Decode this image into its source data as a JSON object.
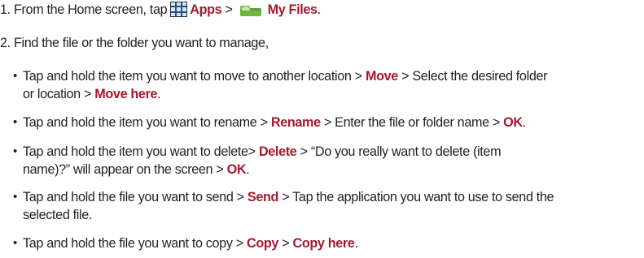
{
  "step1": {
    "number": "1.",
    "text_a": "From the Home screen, tap",
    "apps_label": "Apps",
    "sep": ">",
    "files_label": "My Files",
    "end": "."
  },
  "step2": {
    "number": "2.",
    "text": "Find the file or the folder you want to manage,"
  },
  "bullet_char": "•",
  "move": {
    "t1": "Tap and hold the item you want to move to another location >",
    "k1": "Move",
    "t2": "> Select the desired folder",
    "t3": "or location >",
    "k2": "Move here",
    "end": "."
  },
  "rename": {
    "t1": "Tap and hold the item you want to rename >",
    "k1": "Rename",
    "t2": "> Enter the file or folder name >",
    "k2": "OK",
    "end": "."
  },
  "delete": {
    "t1": "Tap and hold the item you want to delete>",
    "k1": "Delete",
    "t2": "> “Do you really want to delete (item",
    "t3": "name)?” will appear on the screen >",
    "k2": "OK",
    "end": "."
  },
  "send": {
    "t1": "Tap and hold the file you want to send >",
    "k1": "Send",
    "t2": "> Tap the application you want to use to send the",
    "t3": "selected file."
  },
  "copy": {
    "t1": "Tap and hold the file you want to copy >",
    "k1": "Copy",
    "t2": ">",
    "k2": "Copy here",
    "end": "."
  },
  "colors": {
    "highlight": "#a6192e",
    "text": "#231f20"
  },
  "icons": {
    "apps": "apps-grid-icon",
    "files": "my-files-folder-icon"
  }
}
